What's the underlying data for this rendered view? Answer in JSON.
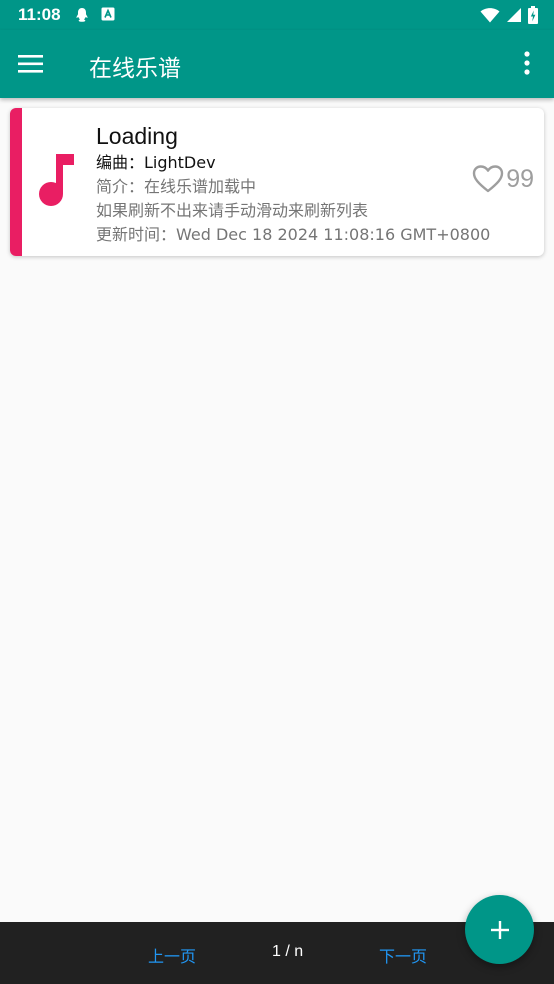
{
  "status_bar": {
    "time": "11:08"
  },
  "app_bar": {
    "title": "在线乐谱"
  },
  "card": {
    "title": "Loading",
    "composer": "编曲：LightDev",
    "intro": "简介：在线乐谱加载中",
    "hint": "如果刷新不出来请手动滑动来刷新列表",
    "updated": "更新时间：Wed Dec 18 2024 11:08:16 GMT+0800",
    "likes": "99",
    "accent_color": "#e91e63"
  },
  "pager": {
    "prev_label": "上一页",
    "page_label": "1 / n",
    "next_label": "下一页"
  },
  "colors": {
    "primary": "#009688",
    "accent": "#e91e63",
    "link": "#2196f3",
    "bottom_bar": "#212121"
  },
  "icons": [
    "menu-icon",
    "more-vert-icon",
    "music-note-icon",
    "heart-outline-icon",
    "add-icon",
    "qq-notification-icon",
    "app-notification-icon",
    "wifi-icon",
    "signal-icon",
    "battery-icon"
  ]
}
